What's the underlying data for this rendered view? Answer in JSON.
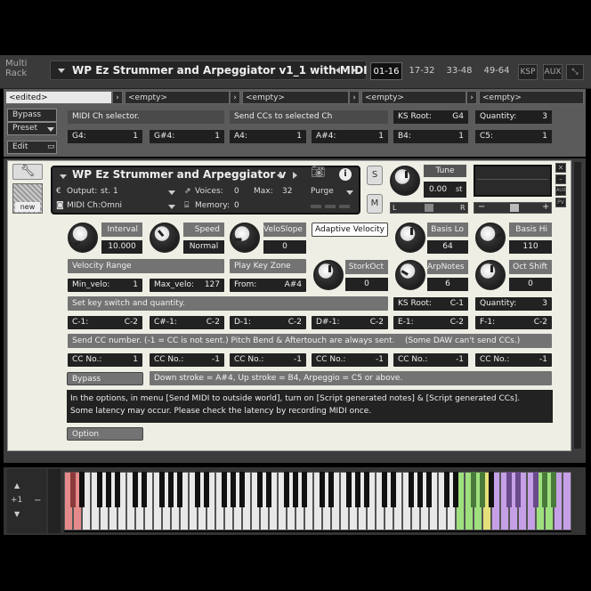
{
  "rack": {
    "label_line1": "Multi",
    "label_line2": "Rack",
    "title": "WP Ez Strummer and Arpeggiator v1_1 with MIDI",
    "midi_tabs": [
      "01-16",
      "17-32",
      "33-48",
      "49-64"
    ],
    "ksp_label": "KSP",
    "aux_label": "AUX"
  },
  "script_tabs": {
    "tab1": "<edited>",
    "tab2": "<empty>",
    "tab3": "<empty>",
    "tab4": "<empty>",
    "tab5": "<empty>"
  },
  "script_side": {
    "bypass": "Bypass",
    "preset": "Preset",
    "edit": "Edit"
  },
  "script_panel": {
    "midi_ch_selector": "MIDI Ch selector.",
    "send_ccs": "Send CCs to selected Ch",
    "ks_root_label": "KS Root:",
    "ks_root_val": "G4",
    "quantity_label": "Quantity:",
    "quantity_val": "3",
    "row": [
      {
        "k": "G4:",
        "v": "1"
      },
      {
        "k": "G#4:",
        "v": "1"
      },
      {
        "k": "A4:",
        "v": "1"
      },
      {
        "k": "A#4:",
        "v": "1"
      },
      {
        "k": "B4:",
        "v": "1"
      },
      {
        "k": "C5:",
        "v": "1"
      }
    ]
  },
  "instrument": {
    "name": "WP Ez Strummer and Arpeggiator v",
    "output_label": "Output:",
    "output_val": "st. 1",
    "midi_label": "MIDI Ch:",
    "midi_val": "Omni",
    "voices_label": "Voices:",
    "voices_val": "0",
    "max_label": "Max:",
    "max_val": "32",
    "memory_label": "Memory:",
    "memory_val": "0",
    "purge_label": "Purge",
    "s_label": "S",
    "m_label": "M",
    "tune_label": "Tune",
    "tune_val": "0.00",
    "tune_unit": "st",
    "pan_l": "L",
    "pan_r": "R",
    "new_label": "new"
  },
  "controls": {
    "interval": {
      "label": "Interval",
      "value": "10.000"
    },
    "speed": {
      "label": "Speed",
      "value": "Normal"
    },
    "veloslope": {
      "label": "VeloSlope",
      "value": "0"
    },
    "adaptive": "Adaptive Velocity",
    "basis_lo": {
      "label": "Basis Lo",
      "value": "64"
    },
    "basis_hi": {
      "label": "Basis Hi",
      "value": "110"
    },
    "velocity_range": "Velocity Range",
    "play_key_zone": "Play Key Zone",
    "storkoct": {
      "label": "StorkOct",
      "value": "0"
    },
    "arpnotes": {
      "label": "ArpNotes",
      "value": "6"
    },
    "octshift": {
      "label": "Oct Shift",
      "value": "0"
    },
    "min_velo_label": "Min_velo:",
    "min_velo_val": "1",
    "max_velo_label": "Max_velo:",
    "max_velo_val": "127",
    "from_label": "From:",
    "from_val": "A#4",
    "set_key": "Set key switch and quantity.",
    "ks_root_label": "KS Root:",
    "ks_root_val": "C-1",
    "quantity_label": "Quantity:",
    "quantity_val": "3",
    "key_row": [
      {
        "k": "C-1:",
        "v": "C-2"
      },
      {
        "k": "C#-1:",
        "v": "C-2"
      },
      {
        "k": "D-1:",
        "v": "C-2"
      },
      {
        "k": "D#-1:",
        "v": "C-2"
      },
      {
        "k": "E-1:",
        "v": "C-2"
      },
      {
        "k": "F-1:",
        "v": "C-2"
      }
    ],
    "send_cc_text": "Send CC number. (-1 = CC is not sent.) Pitch Bend & Aftertouch are always sent.    (Some DAW can't send CCs.)",
    "cc_row": [
      {
        "k": "CC No.:",
        "v": "1"
      },
      {
        "k": "CC No.:",
        "v": "-1"
      },
      {
        "k": "CC No.:",
        "v": "-1"
      },
      {
        "k": "CC No.:",
        "v": "-1"
      },
      {
        "k": "CC No.:",
        "v": "-1"
      },
      {
        "k": "CC No.:",
        "v": "-1"
      }
    ],
    "bypass": "Bypass",
    "stroke_text": "Down stroke = A#4, Up stroke = B4, Arpeggio = C5 or above.",
    "note_line1": "In the options, in menu [Send MIDI to outside world], turn on [Script generated notes] & [Script generated CCs].",
    "note_line2": "Some latency may occur. Please check the latency by recording MIDI once.",
    "option": "Option"
  },
  "keyboard": {
    "octave_label": "+1",
    "minus_label": "−"
  },
  "colors": {
    "key_red": "#e58a8a",
    "key_green": "#9ee07e",
    "key_yellow": "#e6e07a",
    "key_purple": "#c6a0e6"
  }
}
